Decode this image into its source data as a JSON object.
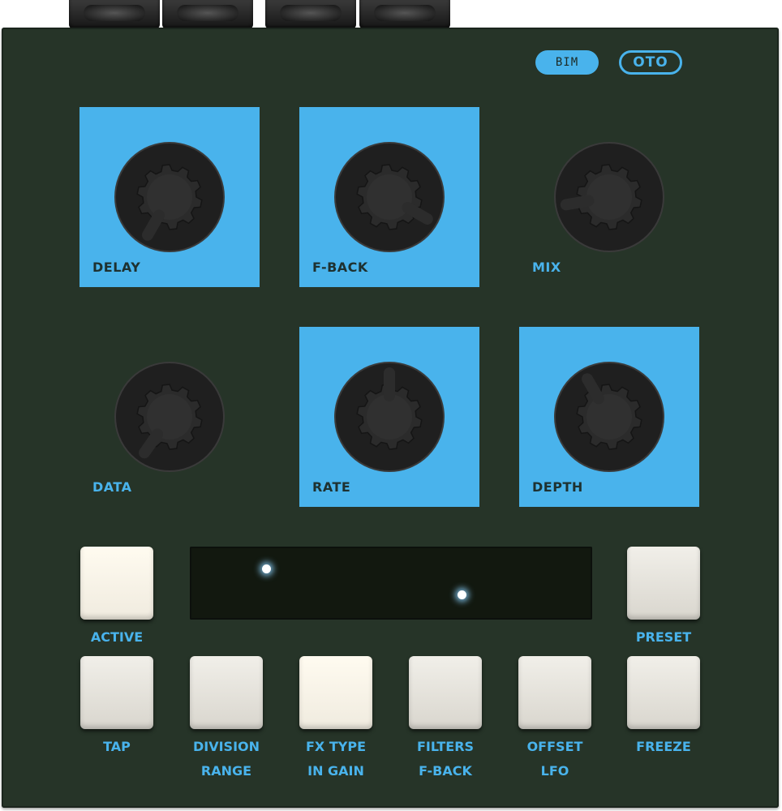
{
  "device": {
    "badge_label": "BIM",
    "brand_label": "OTO",
    "colors": {
      "panel": "#263428",
      "accent": "#49b3ec",
      "knob": "#262626",
      "button": "#e6e3dc"
    }
  },
  "knobs": [
    {
      "label": "DELAY",
      "highlighted": true,
      "pointer_angle_deg": 210
    },
    {
      "label": "F-BACK",
      "highlighted": true,
      "pointer_angle_deg": 120
    },
    {
      "label": "MIX",
      "highlighted": false,
      "pointer_angle_deg": 260
    },
    {
      "label": "DATA",
      "highlighted": false,
      "pointer_angle_deg": 215
    },
    {
      "label": "RATE",
      "highlighted": true,
      "pointer_angle_deg": 0
    },
    {
      "label": "DEPTH",
      "highlighted": true,
      "pointer_angle_deg": 330
    }
  ],
  "buttons": {
    "active": {
      "label": "ACTIVE"
    },
    "preset": {
      "label": "PRESET"
    },
    "tap": {
      "label": "TAP",
      "sublabel": ""
    },
    "division": {
      "label": "DIVISION",
      "sublabel": "RANGE"
    },
    "fx_type": {
      "label": "FX TYPE",
      "sublabel": "IN GAIN"
    },
    "filters": {
      "label": "FILTERS",
      "sublabel": "F-BACK"
    },
    "offset": {
      "label": "OFFSET",
      "sublabel": "LFO"
    },
    "freeze": {
      "label": "FREEZE",
      "sublabel": ""
    }
  },
  "display": {
    "led_count": 2
  }
}
